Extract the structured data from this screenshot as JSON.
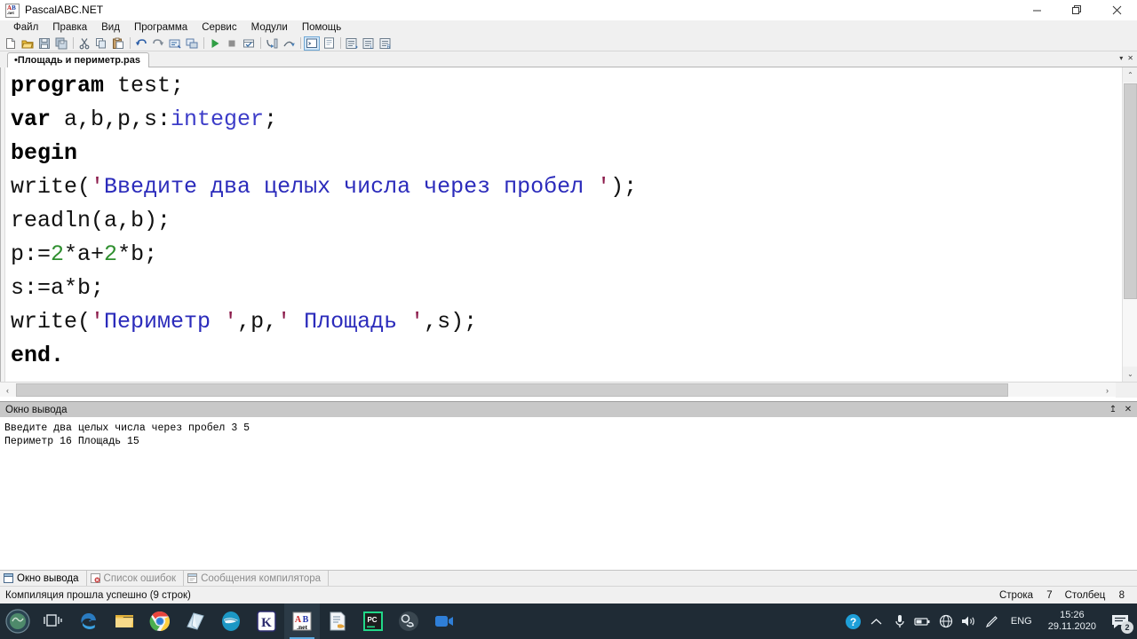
{
  "window": {
    "title": "PascalABC.NET",
    "app_icon": "pascalabc-logo-icon",
    "minimize_label": "–",
    "restore_label": "❐",
    "close_label": "✕"
  },
  "menu": {
    "items": [
      {
        "label": "Файл"
      },
      {
        "label": "Правка"
      },
      {
        "label": "Вид"
      },
      {
        "label": "Программа"
      },
      {
        "label": "Сервис"
      },
      {
        "label": "Модули"
      },
      {
        "label": "Помощь"
      }
    ]
  },
  "toolbar": {
    "buttons": [
      {
        "name": "new-file-icon"
      },
      {
        "name": "open-file-icon"
      },
      {
        "name": "save-file-icon"
      },
      {
        "name": "save-all-icon"
      },
      {
        "name": "cut-icon"
      },
      {
        "name": "copy-icon"
      },
      {
        "name": "paste-icon"
      },
      {
        "name": "undo-icon"
      },
      {
        "name": "redo-icon"
      },
      {
        "name": "find-icon"
      },
      {
        "name": "replace-icon"
      },
      {
        "name": "run-icon"
      },
      {
        "name": "stop-icon"
      },
      {
        "name": "build-icon"
      },
      {
        "name": "step-into-icon"
      },
      {
        "name": "step-over-icon"
      },
      {
        "name": "console-window-icon"
      },
      {
        "name": "error-list-icon"
      },
      {
        "name": "indent-block-icon"
      },
      {
        "name": "comment-block-icon"
      },
      {
        "name": "uncomment-block-icon"
      }
    ]
  },
  "editor": {
    "tab": {
      "label": "•Площадь и периметр.pas",
      "modified": true
    },
    "tab_scroll_left": "▾",
    "tab_scroll_close": "✕",
    "lines": [
      "program test;",
      "var a,b,p,s:integer;",
      "begin",
      "write('Введите два целых числа через пробел ');",
      "readln(a,b);",
      "p:=2*a+2*b;",
      "s:=a*b;",
      "write('Периметр ',p,' Площадь ',s);",
      "end."
    ],
    "tokens": {
      "l1_kw": "program",
      "l1_rest": " test;",
      "l2_kw": "var",
      "l2_vars": " a,b,p,s:",
      "l2_type": "integer",
      "l2_end": ";",
      "l3_kw": "begin",
      "l4_call": "write(",
      "l4_q1": "'",
      "l4_str": "Введите два целых числа через пробел ",
      "l4_q2": "'",
      "l4_end": ");",
      "l5_text": "readln(a,b);",
      "l6_a": "p:=",
      "l6_n1": "2",
      "l6_b": "*a+",
      "l6_n2": "2",
      "l6_c": "*b;",
      "l7_text": "s:=a*b;",
      "l8_call": "write(",
      "l8_q1": "'",
      "l8_str1": "Периметр ",
      "l8_q2": "'",
      "l8_mid": ",p,",
      "l8_q3": "'",
      "l8_str2": " Площадь ",
      "l8_q4": "'",
      "l8_end": ",s);",
      "l9_kw": "end",
      "l9_dot": "."
    },
    "scroll": {
      "up_arrow": "⌃",
      "down_arrow": "⌄",
      "left_arrow": "‹",
      "right_arrow": "›"
    }
  },
  "output_panel": {
    "title": "Окно вывода",
    "pin_icon": "↥",
    "close_icon": "✕",
    "text": "Введите два целых числа через пробел 3 5\nПериметр 16 Площадь 15",
    "lines": [
      "Введите два целых числа через пробел 3 5",
      "Периметр 16 Площадь 15"
    ]
  },
  "bottom_tabs": [
    {
      "label": "Окно вывода",
      "active": true,
      "icon": "output-window-icon"
    },
    {
      "label": "Список ошибок",
      "active": false,
      "icon": "error-list-icon"
    },
    {
      "label": "Сообщения компилятора",
      "active": false,
      "icon": "compiler-messages-icon"
    }
  ],
  "status_bar": {
    "message": "Компиляция прошла успешно (9 строк)",
    "line_label": "Строка",
    "line_value": "7",
    "col_label": "Столбец",
    "col_value": "8"
  },
  "taskbar": {
    "items": [
      {
        "name": "start-button-icon"
      },
      {
        "name": "task-view-icon"
      },
      {
        "name": "microsoft-edge-icon"
      },
      {
        "name": "file-explorer-icon"
      },
      {
        "name": "google-chrome-icon"
      },
      {
        "name": "book-reader-icon"
      },
      {
        "name": "teal-bird-app-icon"
      },
      {
        "name": "kaspersky-icon"
      },
      {
        "name": "pascalabc-net-icon",
        "running": true
      },
      {
        "name": "notepad-document-icon"
      },
      {
        "name": "pycharm-icon"
      },
      {
        "name": "obs-studio-icon"
      },
      {
        "name": "video-camera-icon"
      }
    ],
    "tray": {
      "help_icon": "?",
      "chevron_icon": "⌃",
      "microphone_icon": "mic-icon",
      "battery_icon": "battery-icon",
      "network_icon": "network-globe-icon",
      "volume_icon": "volume-icon",
      "pen_icon": "pen-icon",
      "language": "ENG",
      "time": "15:26",
      "date": "29.11.2020",
      "notification_count": "2"
    }
  },
  "colors": {
    "keyword": "#000000",
    "type": "#3c3cc8",
    "string": "#2b2bbb",
    "quote": "#8b1a4a",
    "number": "#2f8f2f",
    "taskbar_bg": "#1f2b35",
    "accent": "#5aa9e0",
    "panel_header": "#c8c8c8"
  }
}
